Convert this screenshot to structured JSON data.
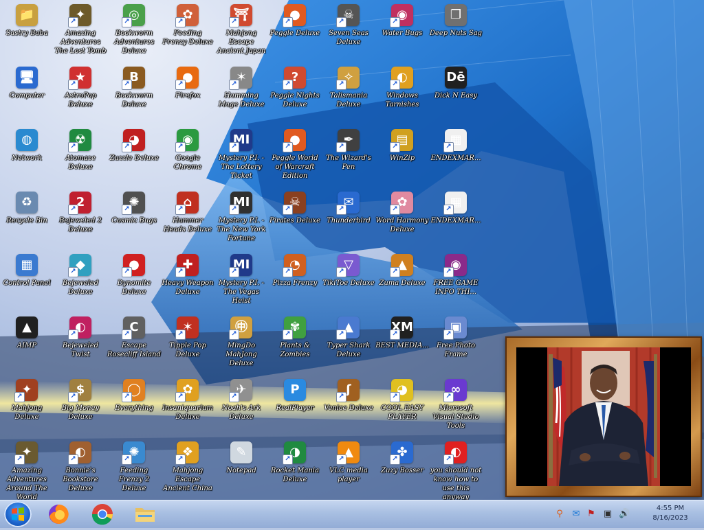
{
  "desktop": {
    "icons": [
      {
        "label": "Sastry Baba",
        "color": "#c8a040",
        "glyph": "📁",
        "col": 0,
        "row": 0,
        "shortcut": false
      },
      {
        "label": "Amazing Adventures The Lost Tomb",
        "color": "#6d5a2a",
        "glyph": "✦",
        "col": 1,
        "row": 0,
        "shortcut": true
      },
      {
        "label": "Bookworm Adventures Deluxe",
        "color": "#4aa04a",
        "glyph": "◎",
        "col": 2,
        "row": 0,
        "shortcut": true
      },
      {
        "label": "Feeding Frenzy Deluxe",
        "color": "#d0603a",
        "glyph": "✿",
        "col": 3,
        "row": 0,
        "shortcut": true
      },
      {
        "label": "Mahjong Escape Ancient Japan",
        "color": "#d04a30",
        "glyph": "⛩",
        "col": 4,
        "row": 0,
        "shortcut": true
      },
      {
        "label": "Peggle Deluxe",
        "color": "#e05a20",
        "glyph": "●",
        "col": 5,
        "row": 0,
        "shortcut": true
      },
      {
        "label": "Seven Seas Deluxe",
        "color": "#555555",
        "glyph": "☠",
        "col": 6,
        "row": 0,
        "shortcut": true
      },
      {
        "label": "Water Bugs",
        "color": "#c03060",
        "glyph": "◉",
        "col": 7,
        "row": 0,
        "shortcut": true
      },
      {
        "label": "Deep Nuts Sag",
        "color": "#707070",
        "glyph": "❐",
        "col": 8,
        "row": 0,
        "shortcut": false
      },
      {
        "label": "Computer",
        "color": "#2a6ad0",
        "glyph": "🖥",
        "col": 0,
        "row": 1,
        "shortcut": false
      },
      {
        "label": "AstroPop Deluxe",
        "color": "#d03030",
        "glyph": "★",
        "col": 1,
        "row": 1,
        "shortcut": true
      },
      {
        "label": "Bookworm Deluxe",
        "color": "#8a5a20",
        "glyph": "B",
        "col": 2,
        "row": 1,
        "shortcut": true
      },
      {
        "label": "Firefox",
        "color": "#e86a10",
        "glyph": "●",
        "col": 3,
        "row": 1,
        "shortcut": true
      },
      {
        "label": "Hamming Mage Deluxe",
        "color": "#888888",
        "glyph": "✶",
        "col": 4,
        "row": 1,
        "shortcut": true
      },
      {
        "label": "Peggle Nights Deluxe",
        "color": "#d04a30",
        "glyph": "?",
        "col": 5,
        "row": 1,
        "shortcut": true
      },
      {
        "label": "Talismania Deluxe",
        "color": "#d0a040",
        "glyph": "✧",
        "col": 6,
        "row": 1,
        "shortcut": true
      },
      {
        "label": "Windows Tarnishes",
        "color": "#e0a020",
        "glyph": "◐",
        "col": 7,
        "row": 1,
        "shortcut": true
      },
      {
        "label": "Dick N Easy",
        "color": "#202020",
        "glyph": "Dē",
        "col": 8,
        "row": 1,
        "shortcut": false
      },
      {
        "label": "Network",
        "color": "#2a8ad0",
        "glyph": "◍",
        "col": 0,
        "row": 2,
        "shortcut": false
      },
      {
        "label": "Atomaze Deluxe",
        "color": "#208a40",
        "glyph": "☢",
        "col": 1,
        "row": 2,
        "shortcut": true
      },
      {
        "label": "Zuzzle Deluxe",
        "color": "#c02020",
        "glyph": "◕",
        "col": 2,
        "row": 2,
        "shortcut": true
      },
      {
        "label": "Google Chrome",
        "color": "#2a9a40",
        "glyph": "◉",
        "col": 3,
        "row": 2,
        "shortcut": true
      },
      {
        "label": "Mystery P.I. - The Lottery Ticket",
        "color": "#203a8a",
        "glyph": "MI",
        "col": 4,
        "row": 2,
        "shortcut": true
      },
      {
        "label": "Peggle World of Warcraft Edition",
        "color": "#e05a20",
        "glyph": "●",
        "col": 5,
        "row": 2,
        "shortcut": true
      },
      {
        "label": "The Wizard's Pen",
        "color": "#404040",
        "glyph": "✒",
        "col": 6,
        "row": 2,
        "shortcut": true
      },
      {
        "label": "WinZip",
        "color": "#d0a020",
        "glyph": "▤",
        "col": 7,
        "row": 2,
        "shortcut": true
      },
      {
        "label": "ENDEXMAR...",
        "color": "#f0f0f0",
        "glyph": "▦",
        "col": 8,
        "row": 2,
        "shortcut": true
      },
      {
        "label": "Recycle Bin",
        "color": "#6a8ab0",
        "glyph": "♻",
        "col": 0,
        "row": 3,
        "shortcut": false
      },
      {
        "label": "Bejeweled 2 Deluxe",
        "color": "#c02030",
        "glyph": "2",
        "col": 1,
        "row": 3,
        "shortcut": true
      },
      {
        "label": "Cosmic Bugs",
        "color": "#505050",
        "glyph": "✺",
        "col": 2,
        "row": 3,
        "shortcut": true
      },
      {
        "label": "Hammer Heads Deluxe",
        "color": "#c03020",
        "glyph": "⌂",
        "col": 3,
        "row": 3,
        "shortcut": true
      },
      {
        "label": "Mystery P.I. - The New York Fortune",
        "color": "#303030",
        "glyph": "MI",
        "col": 4,
        "row": 3,
        "shortcut": true
      },
      {
        "label": "Pirates Deluxe",
        "color": "#8a4020",
        "glyph": "☠",
        "col": 5,
        "row": 3,
        "shortcut": true
      },
      {
        "label": "Thunderbird",
        "color": "#2a6ad0",
        "glyph": "✉",
        "col": 6,
        "row": 3,
        "shortcut": true
      },
      {
        "label": "Word Harmony Deluxe",
        "color": "#e08aa0",
        "glyph": "✿",
        "col": 7,
        "row": 3,
        "shortcut": true
      },
      {
        "label": "ENDEXMAR...",
        "color": "#f0f0f0",
        "glyph": "▦",
        "col": 8,
        "row": 3,
        "shortcut": true
      },
      {
        "label": "Control Panel",
        "color": "#3a7ad0",
        "glyph": "▦",
        "col": 0,
        "row": 4,
        "shortcut": false
      },
      {
        "label": "Bejeweled Deluxe",
        "color": "#30a0c0",
        "glyph": "◆",
        "col": 1,
        "row": 4,
        "shortcut": true
      },
      {
        "label": "Dynomite Deluxe",
        "color": "#d02020",
        "glyph": "●",
        "col": 2,
        "row": 4,
        "shortcut": true
      },
      {
        "label": "Heavy Weapon Deluxe",
        "color": "#c02020",
        "glyph": "✚",
        "col": 3,
        "row": 4,
        "shortcut": true
      },
      {
        "label": "Mystery P.I. - The Vegas Heist",
        "color": "#203a8a",
        "glyph": "MI",
        "col": 4,
        "row": 4,
        "shortcut": true
      },
      {
        "label": "Pizza Frenzy",
        "color": "#d06020",
        "glyph": "◔",
        "col": 5,
        "row": 4,
        "shortcut": true
      },
      {
        "label": "TikiToe Deluxe",
        "color": "#7a5ad0",
        "glyph": "▽",
        "col": 6,
        "row": 4,
        "shortcut": true
      },
      {
        "label": "Zuma Deluxe",
        "color": "#d08020",
        "glyph": "▲",
        "col": 7,
        "row": 4,
        "shortcut": true
      },
      {
        "label": "FREE GAME INFO THI...",
        "color": "#8a2a8a",
        "glyph": "◉",
        "col": 8,
        "row": 4,
        "shortcut": true
      },
      {
        "label": "AIMP",
        "color": "#202020",
        "glyph": "▲",
        "col": 0,
        "row": 5,
        "shortcut": false
      },
      {
        "label": "Bejeweled Twist",
        "color": "#c02060",
        "glyph": "◐",
        "col": 1,
        "row": 5,
        "shortcut": true
      },
      {
        "label": "Escape Rosecliff Island",
        "color": "#606060",
        "glyph": "C",
        "col": 2,
        "row": 5,
        "shortcut": true
      },
      {
        "label": "Tipple Pop Deluxe",
        "color": "#c03020",
        "glyph": "✶",
        "col": 3,
        "row": 5,
        "shortcut": true
      },
      {
        "label": "MingDo MahJong Deluxe",
        "color": "#d0a040",
        "glyph": "㊥",
        "col": 4,
        "row": 5,
        "shortcut": true
      },
      {
        "label": "Plants & Zombies",
        "color": "#40a040",
        "glyph": "✾",
        "col": 5,
        "row": 5,
        "shortcut": true
      },
      {
        "label": "Typer Shark Deluxe",
        "color": "#4a7ad0",
        "glyph": "▲",
        "col": 6,
        "row": 5,
        "shortcut": true
      },
      {
        "label": "BEST MEDIA...",
        "color": "#202020",
        "glyph": "XM",
        "col": 7,
        "row": 5,
        "shortcut": true
      },
      {
        "label": "Free Photo Frame",
        "color": "#6a8ad0",
        "glyph": "▣",
        "col": 8,
        "row": 5,
        "shortcut": true
      },
      {
        "label": "Mahjong Deluxe",
        "color": "#a04020",
        "glyph": "✦",
        "col": 0,
        "row": 6,
        "shortcut": true
      },
      {
        "label": "Big Money Deluxe",
        "color": "#a08040",
        "glyph": "$",
        "col": 1,
        "row": 6,
        "shortcut": true
      },
      {
        "label": "Everything",
        "color": "#e08020",
        "glyph": "◯",
        "col": 2,
        "row": 6,
        "shortcut": true
      },
      {
        "label": "Insaniquarium Deluxe",
        "color": "#e0a020",
        "glyph": "✿",
        "col": 3,
        "row": 6,
        "shortcut": true
      },
      {
        "label": "Noah's Ark Deluxe",
        "color": "#909090",
        "glyph": "✈",
        "col": 4,
        "row": 6,
        "shortcut": true
      },
      {
        "label": "RealPlayer",
        "color": "#2a8ae0",
        "glyph": "P",
        "col": 5,
        "row": 6,
        "shortcut": false
      },
      {
        "label": "Venice Deluxe",
        "color": "#a06020",
        "glyph": "ʃ",
        "col": 6,
        "row": 6,
        "shortcut": true
      },
      {
        "label": "COOL EASY PLAYER",
        "color": "#e0c020",
        "glyph": "◕",
        "col": 7,
        "row": 6,
        "shortcut": true
      },
      {
        "label": "Microsoft Visual Studio Tools",
        "color": "#6a3ad0",
        "glyph": "∞",
        "col": 8,
        "row": 6,
        "shortcut": true
      },
      {
        "label": "Amazing Adventures Around The World",
        "color": "#6a5a30",
        "glyph": "✦",
        "col": 0,
        "row": 7,
        "shortcut": true
      },
      {
        "label": "Bonnie's Bookstore Deluxe",
        "color": "#a06030",
        "glyph": "◐",
        "col": 1,
        "row": 7,
        "shortcut": true
      },
      {
        "label": "Feeding Frenzy 2 Deluxe",
        "color": "#3a8ad0",
        "glyph": "✺",
        "col": 2,
        "row": 7,
        "shortcut": true
      },
      {
        "label": "Mahjong Escape Ancient China",
        "color": "#e0a020",
        "glyph": "❖",
        "col": 3,
        "row": 7,
        "shortcut": true
      },
      {
        "label": "Notepad",
        "color": "#d0d8e0",
        "glyph": "✎",
        "col": 4,
        "row": 7,
        "shortcut": false
      },
      {
        "label": "Rocket Mania Deluxe",
        "color": "#208a40",
        "glyph": "◑",
        "col": 5,
        "row": 7,
        "shortcut": true
      },
      {
        "label": "VLC media player",
        "color": "#f08a10",
        "glyph": "▲",
        "col": 6,
        "row": 7,
        "shortcut": true
      },
      {
        "label": "Zuzy Bosser",
        "color": "#2a6ad0",
        "glyph": "✤",
        "col": 7,
        "row": 7,
        "shortcut": true
      },
      {
        "label": "you should not know how to use this anyway",
        "color": "#e02020",
        "glyph": "◐",
        "col": 8,
        "row": 7,
        "shortcut": true
      }
    ]
  },
  "photo_frame": {
    "caption": "",
    "frame_color": "#b4742c"
  },
  "taskbar": {
    "start_label": "Start",
    "pinned": [
      {
        "name": "Firefox",
        "color": "#e86a10"
      },
      {
        "name": "Google Chrome",
        "color": "#2a9a40"
      },
      {
        "name": "File Explorer",
        "color": "#e0c060"
      }
    ],
    "tray": [
      {
        "name": "search",
        "glyph": "⚲",
        "color": "#e05a10"
      },
      {
        "name": "messenger",
        "glyph": "✉",
        "color": "#1e7ad6"
      },
      {
        "name": "flag",
        "glyph": "⚑",
        "color": "#c02020"
      },
      {
        "name": "network",
        "glyph": "▣",
        "color": "#303030"
      },
      {
        "name": "volume",
        "glyph": "🔊",
        "color": "#303030"
      }
    ],
    "clock_time": "4:55 PM",
    "clock_date": "8/16/2023"
  }
}
